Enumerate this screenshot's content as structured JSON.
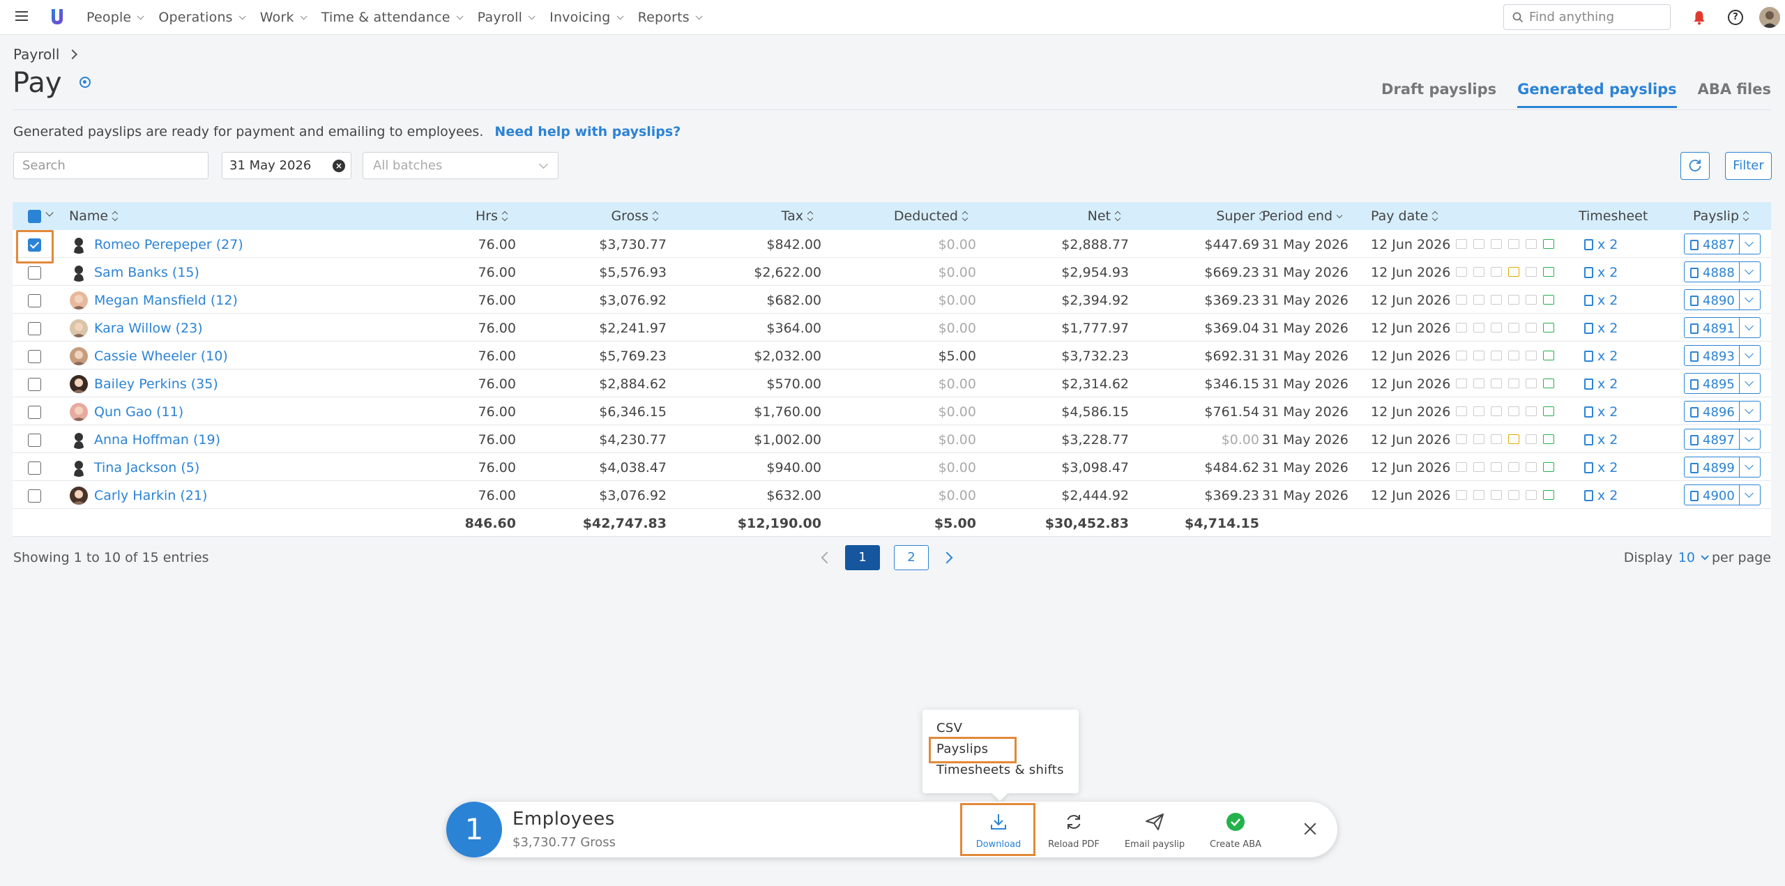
{
  "nav": {
    "items": [
      {
        "label": "People"
      },
      {
        "label": "Operations"
      },
      {
        "label": "Work"
      },
      {
        "label": "Time & attendance"
      },
      {
        "label": "Payroll"
      },
      {
        "label": "Invoicing"
      },
      {
        "label": "Reports"
      }
    ],
    "search_placeholder": "Find anything"
  },
  "page": {
    "breadcrumb": "Payroll",
    "title": "Pay",
    "tabs": [
      {
        "label": "Draft payslips",
        "active": false
      },
      {
        "label": "Generated payslips",
        "active": true
      },
      {
        "label": "ABA files",
        "active": false
      }
    ],
    "intro": "Generated payslips are ready for payment and emailing to employees.",
    "help_link": "Need help with payslips?"
  },
  "filters": {
    "search_placeholder": "Search",
    "date": "31 May 2026",
    "batches_placeholder": "All batches",
    "filter_label": "Filter"
  },
  "table": {
    "columns": {
      "name": "Name",
      "hrs": "Hrs",
      "gross": "Gross",
      "tax": "Tax",
      "deducted": "Deducted",
      "net": "Net",
      "super": "Super",
      "period_end": "Period end",
      "pay_date": "Pay date",
      "timesheet": "Timesheet",
      "payslip": "Payslip"
    },
    "rows": [
      {
        "name": "Romeo Perepeper (27)",
        "hrs": "76.00",
        "gross": "$3,730.77",
        "tax": "$842.00",
        "deducted": "$0.00",
        "net": "$2,888.77",
        "super": "$447.69",
        "period_end": "31 May 2026",
        "pay_date": "12 Jun 2026",
        "timesheet": "x 2",
        "payslip": "4887",
        "checked": true,
        "award_warn": false
      },
      {
        "name": "Sam Banks (15)",
        "hrs": "76.00",
        "gross": "$5,576.93",
        "tax": "$2,622.00",
        "deducted": "$0.00",
        "net": "$2,954.93",
        "super": "$669.23",
        "period_end": "31 May 2026",
        "pay_date": "12 Jun 2026",
        "timesheet": "x 2",
        "payslip": "4888",
        "checked": false,
        "award_warn": true
      },
      {
        "name": "Megan Mansfield (12)",
        "hrs": "76.00",
        "gross": "$3,076.92",
        "tax": "$682.00",
        "deducted": "$0.00",
        "net": "$2,394.92",
        "super": "$369.23",
        "period_end": "31 May 2026",
        "pay_date": "12 Jun 2026",
        "timesheet": "x 2",
        "payslip": "4890",
        "checked": false,
        "award_warn": false
      },
      {
        "name": "Kara Willow (23)",
        "hrs": "76.00",
        "gross": "$2,241.97",
        "tax": "$364.00",
        "deducted": "$0.00",
        "net": "$1,777.97",
        "super": "$369.04",
        "period_end": "31 May 2026",
        "pay_date": "12 Jun 2026",
        "timesheet": "x 2",
        "payslip": "4891",
        "checked": false,
        "award_warn": false
      },
      {
        "name": "Cassie Wheeler (10)",
        "hrs": "76.00",
        "gross": "$5,769.23",
        "tax": "$2,032.00",
        "deducted": "$5.00",
        "net": "$3,732.23",
        "super": "$692.31",
        "period_end": "31 May 2026",
        "pay_date": "12 Jun 2026",
        "timesheet": "x 2",
        "payslip": "4893",
        "checked": false,
        "award_warn": false
      },
      {
        "name": "Bailey Perkins (35)",
        "hrs": "76.00",
        "gross": "$2,884.62",
        "tax": "$570.00",
        "deducted": "$0.00",
        "net": "$2,314.62",
        "super": "$346.15",
        "period_end": "31 May 2026",
        "pay_date": "12 Jun 2026",
        "timesheet": "x 2",
        "payslip": "4895",
        "checked": false,
        "award_warn": false
      },
      {
        "name": "Qun Gao (11)",
        "hrs": "76.00",
        "gross": "$6,346.15",
        "tax": "$1,760.00",
        "deducted": "$0.00",
        "net": "$4,586.15",
        "super": "$761.54",
        "period_end": "31 May 2026",
        "pay_date": "12 Jun 2026",
        "timesheet": "x 2",
        "payslip": "4896",
        "checked": false,
        "award_warn": false
      },
      {
        "name": "Anna Hoffman (19)",
        "hrs": "76.00",
        "gross": "$4,230.77",
        "tax": "$1,002.00",
        "deducted": "$0.00",
        "net": "$3,228.77",
        "super": "$0.00",
        "period_end": "31 May 2026",
        "pay_date": "12 Jun 2026",
        "timesheet": "x 2",
        "payslip": "4897",
        "checked": false,
        "award_warn": true
      },
      {
        "name": "Tina Jackson (5)",
        "hrs": "76.00",
        "gross": "$4,038.47",
        "tax": "$940.00",
        "deducted": "$0.00",
        "net": "$3,098.47",
        "super": "$484.62",
        "period_end": "31 May 2026",
        "pay_date": "12 Jun 2026",
        "timesheet": "x 2",
        "payslip": "4899",
        "checked": false,
        "award_warn": false
      },
      {
        "name": "Carly Harkin (21)",
        "hrs": "76.00",
        "gross": "$3,076.92",
        "tax": "$632.00",
        "deducted": "$0.00",
        "net": "$2,444.92",
        "super": "$369.23",
        "period_end": "31 May 2026",
        "pay_date": "12 Jun 2026",
        "timesheet": "x 2",
        "payslip": "4900",
        "checked": false,
        "award_warn": false
      }
    ],
    "totals": {
      "hrs": "846.60",
      "gross": "$42,747.83",
      "tax": "$12,190.00",
      "deducted": "$5.00",
      "net": "$30,452.83",
      "super": "$4,714.15"
    }
  },
  "pagination": {
    "showing": "Showing 1 to 10 of 15 entries",
    "pages": [
      "1",
      "2"
    ],
    "current": "1",
    "display_prefix": "Display",
    "display_value": "10",
    "display_suffix": "per page"
  },
  "download_menu": {
    "items": [
      "CSV",
      "Payslips",
      "Timesheets & shifts"
    ],
    "highlighted": "Payslips"
  },
  "action_bar": {
    "count": "1",
    "title": "Employees",
    "subtitle": "$3,730.77 Gross",
    "actions": [
      {
        "label": "Download",
        "icon": "download-icon"
      },
      {
        "label": "Reload PDF",
        "icon": "reload-icon"
      },
      {
        "label": "Email payslip",
        "icon": "send-icon"
      },
      {
        "label": "Create ABA",
        "icon": "check-circle-icon"
      }
    ]
  },
  "colors": {
    "accent": "#2b83d5",
    "highlight": "#e2893a",
    "header_bg": "#d6eefb",
    "page_active": "#15569e"
  }
}
